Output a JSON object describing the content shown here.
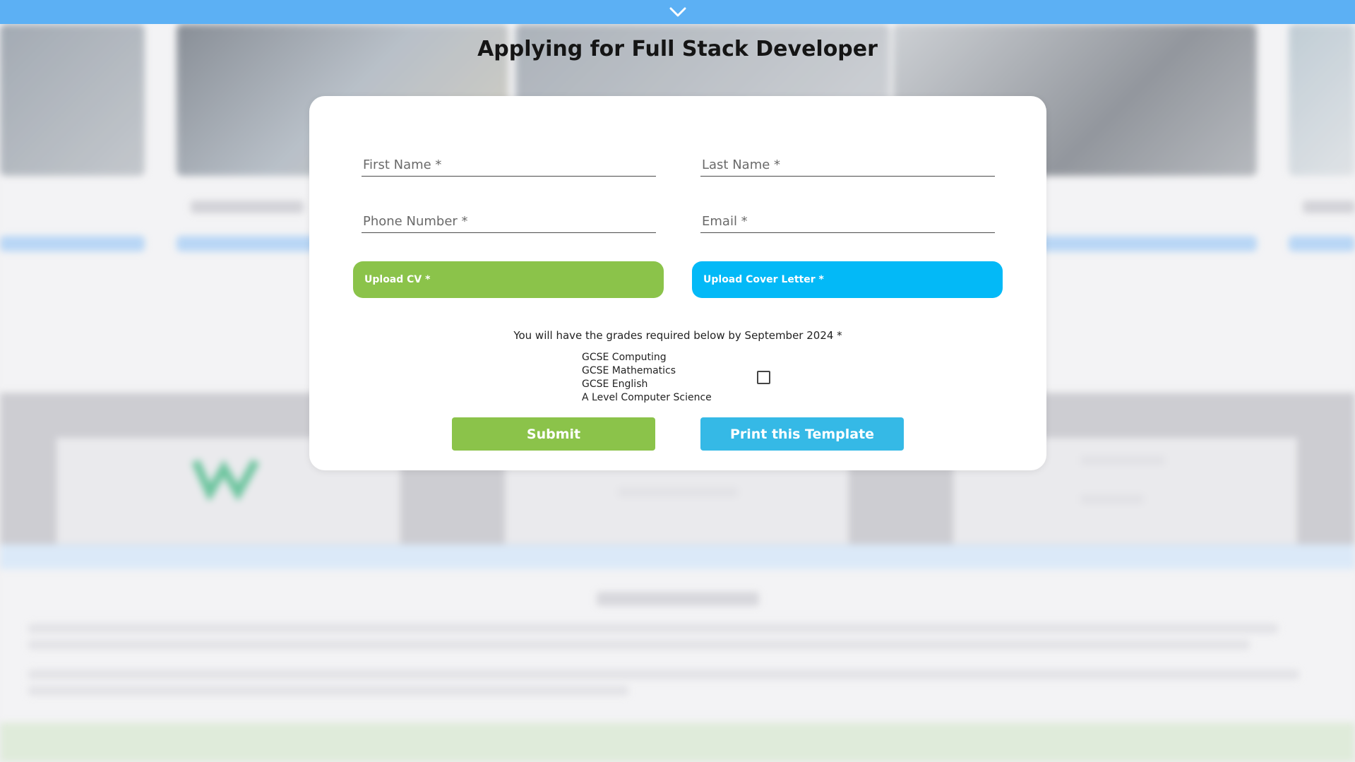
{
  "page": {
    "title": "Applying for Full Stack Developer"
  },
  "form": {
    "first_name_placeholder": "First Name *",
    "last_name_placeholder": "Last Name *",
    "phone_placeholder": "Phone Number *",
    "email_placeholder": "Email *",
    "upload_cv_label": "Upload CV *",
    "upload_cover_letter_label": "Upload Cover Letter *",
    "grades_label": "You will have the grades required below by September 2024 *",
    "grades": [
      "GCSE Computing",
      "GCSE Mathematics",
      "GCSE English",
      "A Level Computer Science"
    ],
    "grades_checked": false,
    "submit_label": "Submit",
    "print_label": "Print this Template"
  },
  "colors": {
    "top_bar": "#5cb0f4",
    "green_button": "#8bc34a",
    "cyan_upload": "#03b9f7",
    "print_button": "#35b9e6"
  },
  "icons": {
    "top_bar_toggle": "chevron-down-icon"
  }
}
